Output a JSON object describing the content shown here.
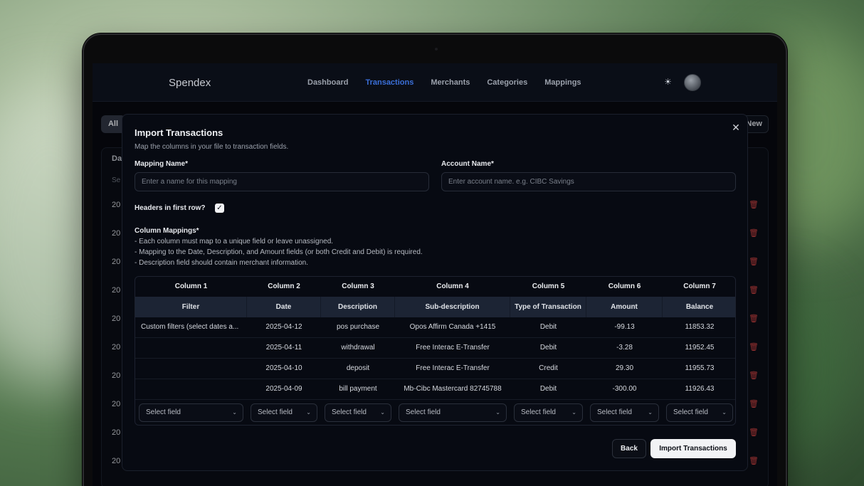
{
  "app": {
    "brand": "Spendex"
  },
  "nav": {
    "items": [
      {
        "label": "Dashboard"
      },
      {
        "label": "Transactions"
      },
      {
        "label": "Merchants"
      },
      {
        "label": "Categories"
      },
      {
        "label": "Mappings"
      }
    ],
    "active": "Transactions"
  },
  "page": {
    "tab_all": "All",
    "new_button": "New",
    "table_head_fragment": "Da",
    "search_fragment": "Se",
    "row_fragment": "20"
  },
  "modal": {
    "title": "Import Transactions",
    "subtitle": "Map the columns in your file to transaction fields.",
    "mapping_name_label": "Mapping Name*",
    "mapping_name_placeholder": "Enter a name for this mapping",
    "account_name_label": "Account Name*",
    "account_name_placeholder": "Enter account name. e.g. CIBC Savings",
    "headers_label": "Headers in first row?",
    "headers_checked": true,
    "column_mappings_heading": "Column Mappings*",
    "notes": [
      "- Each column must map to a unique field or leave unassigned.",
      "- Mapping to the Date, Description, and Amount fields (or both Credit and Debit) is required.",
      "- Description field should contain merchant information."
    ],
    "columns": [
      "Column 1",
      "Column 2",
      "Column 3",
      "Column 4",
      "Column 5",
      "Column 6",
      "Column 7"
    ],
    "headers": [
      "Filter",
      "Date",
      "Description",
      "Sub-description",
      "Type of Transaction",
      "Amount",
      "Balance"
    ],
    "rows": [
      [
        "Custom filters (select dates a...",
        "2025-04-12",
        "pos purchase",
        "Opos Affirm Canada +1415",
        "Debit",
        "-99.13",
        "11853.32"
      ],
      [
        "",
        "2025-04-11",
        "withdrawal",
        "Free Interac E-Transfer",
        "Debit",
        "-3.28",
        "11952.45"
      ],
      [
        "",
        "2025-04-10",
        "deposit",
        "Free Interac E-Transfer",
        "Credit",
        "29.30",
        "11955.73"
      ],
      [
        "",
        "2025-04-09",
        "bill payment",
        "Mb-Cibc Mastercard 82745788",
        "Debit",
        "-300.00",
        "11926.43"
      ]
    ],
    "select_placeholder": "Select field",
    "back_label": "Back",
    "import_label": "Import Transactions"
  },
  "colors": {
    "accent": "#3b6fd8",
    "danger": "#c74040"
  }
}
